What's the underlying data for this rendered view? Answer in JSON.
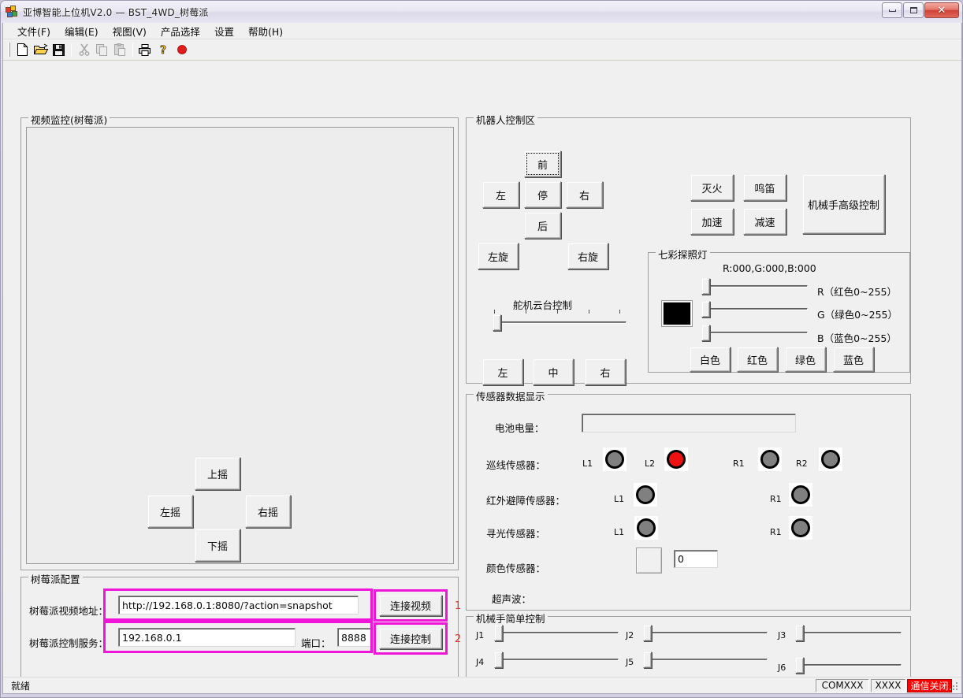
{
  "window": {
    "title": "亚博智能上位机V2.0 — BST_4WD_树莓派",
    "minimize_label": "最小化",
    "maximize_label": "最大化",
    "close_label": "✕"
  },
  "menu": [
    {
      "label": "文件(F)"
    },
    {
      "label": "编辑(E)"
    },
    {
      "label": "视图(V)"
    },
    {
      "label": "产品选择"
    },
    {
      "label": "设置"
    },
    {
      "label": "帮助(H)"
    }
  ],
  "toolbar": {
    "icons": [
      {
        "name": "new-file-icon"
      },
      {
        "name": "open-folder-icon"
      },
      {
        "name": "save-disk-icon"
      },
      {
        "name": "cut-scissors-icon"
      },
      {
        "name": "copy-icon"
      },
      {
        "name": "paste-icon"
      },
      {
        "name": "print-icon"
      },
      {
        "name": "help-question-icon"
      },
      {
        "name": "record-circle-icon"
      }
    ]
  },
  "video_panel": {
    "title": "视频监控(树莓派)",
    "pan_tilt": {
      "up": "上摇",
      "left": "左摇",
      "right": "右摇",
      "down": "下摇"
    }
  },
  "rpi_config": {
    "title": "树莓派配置",
    "video_addr_label": "树莓派视频地址：",
    "video_addr_value": "http://192.168.0.1:8080/?action=snapshot",
    "connect_video_button": "连接视频",
    "ctrl_service_label": "树莓派控制服务：",
    "ctrl_service_value": "192.168.0.1",
    "port_label": "端口：",
    "port_value": "8888",
    "connect_ctrl_button": "连接控制",
    "marker_1": "1",
    "marker_2": "2"
  },
  "robot_control": {
    "title": "机器人控制区",
    "dpad": {
      "forward": "前",
      "left": "左",
      "stop": "停",
      "right": "右",
      "back": "后",
      "rot_left": "左旋",
      "rot_right": "右旋"
    },
    "actions": {
      "fire": "灭火",
      "horn": "鸣笛",
      "accel": "加速",
      "decel": "减速",
      "arm_advanced": "机械手高级控制"
    },
    "gimbal": {
      "title": "舵机云台控制",
      "left": "左",
      "center": "中",
      "right": "右",
      "value": 0
    }
  },
  "rgb_light": {
    "title": "七彩探照灯",
    "readout": "R:000,G:000,B:000",
    "preview_color": "#000000",
    "channels": [
      {
        "name": "R",
        "label": "R（红色0~255）",
        "value": 0
      },
      {
        "name": "G",
        "label": "G（绿色0~255）",
        "value": 0
      },
      {
        "name": "B",
        "label": "B（蓝色0~255）",
        "value": 0
      }
    ],
    "presets": [
      {
        "label": "白色"
      },
      {
        "label": "红色"
      },
      {
        "label": "绿色"
      },
      {
        "label": "蓝色"
      }
    ]
  },
  "sensors": {
    "title": "传感器数据显示",
    "battery_label": "电池电量：",
    "battery_value": "",
    "line_label": "巡线传感器：",
    "line_leds": [
      {
        "tag": "L1",
        "state": "off"
      },
      {
        "tag": "L2",
        "state": "on"
      },
      {
        "tag": "R1",
        "state": "off"
      },
      {
        "tag": "R2",
        "state": "off"
      }
    ],
    "ir_label": "红外避障传感器：",
    "ir_leds": [
      {
        "tag": "L1",
        "state": "off"
      },
      {
        "tag": "R1",
        "state": "off"
      }
    ],
    "light_label": "寻光传感器：",
    "light_leds": [
      {
        "tag": "L1",
        "state": "off"
      },
      {
        "tag": "R1",
        "state": "off"
      }
    ],
    "color_label": "颜色传感器：",
    "color_swatch": "#f0f0f0",
    "color_value": "0",
    "ultrasonic_label": "超声波："
  },
  "arm_simple": {
    "title": "机械手简单控制",
    "joints": [
      {
        "label": "J1",
        "value": 0
      },
      {
        "label": "J2",
        "value": 0
      },
      {
        "label": "J3",
        "value": 0
      },
      {
        "label": "J4",
        "value": 0
      },
      {
        "label": "J5",
        "value": 0
      },
      {
        "label": "J6",
        "value": 0
      }
    ]
  },
  "statusbar": {
    "ready": "就绪",
    "com": "COMXXX",
    "baud": "XXXX",
    "comm_state": "通信关闭",
    "comm_state_color": "#ff0000"
  }
}
